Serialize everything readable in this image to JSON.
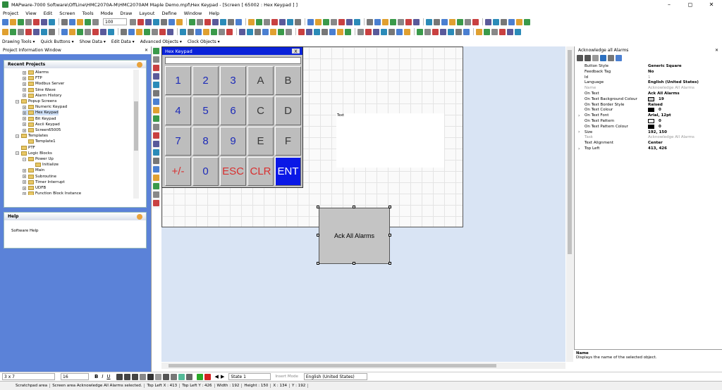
{
  "app": {
    "title": "MAPware-7000 Software\\OffLine\\HMC2070A-M\\HMC2070AM Maple Demo.mpf\\Hex Keypad - [Screen [ 65002 : Hex Keypad ] ]",
    "window_buttons": [
      "–",
      "◻",
      "✕"
    ]
  },
  "menu": [
    "Project",
    "View",
    "Edit",
    "Screen",
    "Tools",
    "Mode",
    "Draw",
    "Layout",
    "Define",
    "Window",
    "Help"
  ],
  "toolbar": {
    "zoom": "100",
    "row3": [
      "Drawing Tools ▾",
      "Quick Buttons ▾",
      "Show Data ▾",
      "Edit Data ▾",
      "Advanced Objects ▾",
      "Clock Objects ▾"
    ]
  },
  "left": {
    "title": "Project Information Window",
    "close": "✕",
    "recent_title": "Recent Projects",
    "tree": [
      {
        "label": "Alarms",
        "indent": 2,
        "pm": "+"
      },
      {
        "label": "FTP",
        "indent": 2,
        "pm": "+"
      },
      {
        "label": "Modbus Server",
        "indent": 2,
        "pm": "+"
      },
      {
        "label": "Sine Wave",
        "indent": 2,
        "pm": "+"
      },
      {
        "label": "Alarm History",
        "indent": 2,
        "pm": "+"
      },
      {
        "label": "Popup Screens",
        "indent": 1,
        "pm": "−"
      },
      {
        "label": "Numeric Keypad",
        "indent": 2,
        "pm": "+"
      },
      {
        "label": "Hex Keypad",
        "indent": 2,
        "pm": "+",
        "sel": true
      },
      {
        "label": "Bit Keypad",
        "indent": 2,
        "pm": "+"
      },
      {
        "label": "Ascii Keypad",
        "indent": 2,
        "pm": "+"
      },
      {
        "label": "Screen65005",
        "indent": 2,
        "pm": "+"
      },
      {
        "label": "Templates",
        "indent": 1,
        "pm": "−"
      },
      {
        "label": "Template1",
        "indent": 2,
        "pm": ""
      },
      {
        "label": "PTF",
        "indent": 1,
        "pm": ""
      },
      {
        "label": "Logic Blocks",
        "indent": 1,
        "pm": "−"
      },
      {
        "label": "Power Up",
        "indent": 2,
        "pm": "−"
      },
      {
        "label": "Initialize",
        "indent": 3,
        "pm": ""
      },
      {
        "label": "Main",
        "indent": 2,
        "pm": "+"
      },
      {
        "label": "Subroutine",
        "indent": 2,
        "pm": "+"
      },
      {
        "label": "Timer Interrupt",
        "indent": 2,
        "pm": "+"
      },
      {
        "label": "UDFB",
        "indent": 2,
        "pm": "+"
      },
      {
        "label": "Function Block Instance",
        "indent": 2,
        "pm": "+"
      }
    ],
    "help_title": "Help",
    "help_text": "Software Help"
  },
  "keypad": {
    "title": "Hex Keypad",
    "close": "X",
    "keys": [
      [
        "1",
        "2",
        "3",
        "A",
        "B"
      ],
      [
        "4",
        "5",
        "6",
        "C",
        "D"
      ],
      [
        "7",
        "8",
        "9",
        "E",
        "F"
      ],
      [
        "+/-",
        "0",
        "ESC",
        "CLR",
        "ENT"
      ]
    ]
  },
  "canvas": {
    "text_label": "Text",
    "button_label": "Ack All Alarms"
  },
  "props": {
    "title": "Acknowledge all Alarms",
    "close": "✕",
    "rows": [
      {
        "n": "Button Style",
        "v": "Generic Square"
      },
      {
        "n": "Feedback Tag",
        "v": "No"
      },
      {
        "n": "Id",
        "v": "1",
        "dim": true
      },
      {
        "n": "Language",
        "v": "English (United States)"
      },
      {
        "n": "Name",
        "v": "Acknowledge All Alarms",
        "dimn": true,
        "dim": true
      },
      {
        "n": "On Text",
        "v": "Ack All Alarms"
      },
      {
        "n": "On Text Background Colour",
        "v": "19",
        "sw": "#c8c8c8"
      },
      {
        "n": "On Text Border Style",
        "v": "Raised"
      },
      {
        "n": "On Text Colour",
        "v": "0",
        "sw": "#000000"
      },
      {
        "n": "On Text Font",
        "v": "Arial, 12pt",
        "exp": true
      },
      {
        "n": "On Text Pattern",
        "v": "0",
        "sw": "#ffffff"
      },
      {
        "n": "On Text Pattern Colour",
        "v": "0",
        "sw": "#000000"
      },
      {
        "n": "Size",
        "v": "192, 150",
        "exp": true
      },
      {
        "n": "Task",
        "v": "Acknowledge All Alarms",
        "dimn": true,
        "dim": true
      },
      {
        "n": "Text Alignment",
        "v": "Center"
      },
      {
        "n": "Top Left",
        "v": "413, 426",
        "exp": true
      }
    ],
    "desc_title": "Name",
    "desc_text": "Displays the name of the selected object."
  },
  "fmt": {
    "size": "3 x 7",
    "font_size": "16",
    "state": "State 1",
    "insert_mode": "Insert Mode",
    "language": "English (United States)"
  },
  "status": [
    "Scratchpad area",
    "Screen area  Acknowledge All Alarms selected.",
    "Top Left X : 413",
    "Top Left Y : 426",
    "Width : 192",
    "Height : 150",
    "X : 134",
    "Y : 192"
  ]
}
